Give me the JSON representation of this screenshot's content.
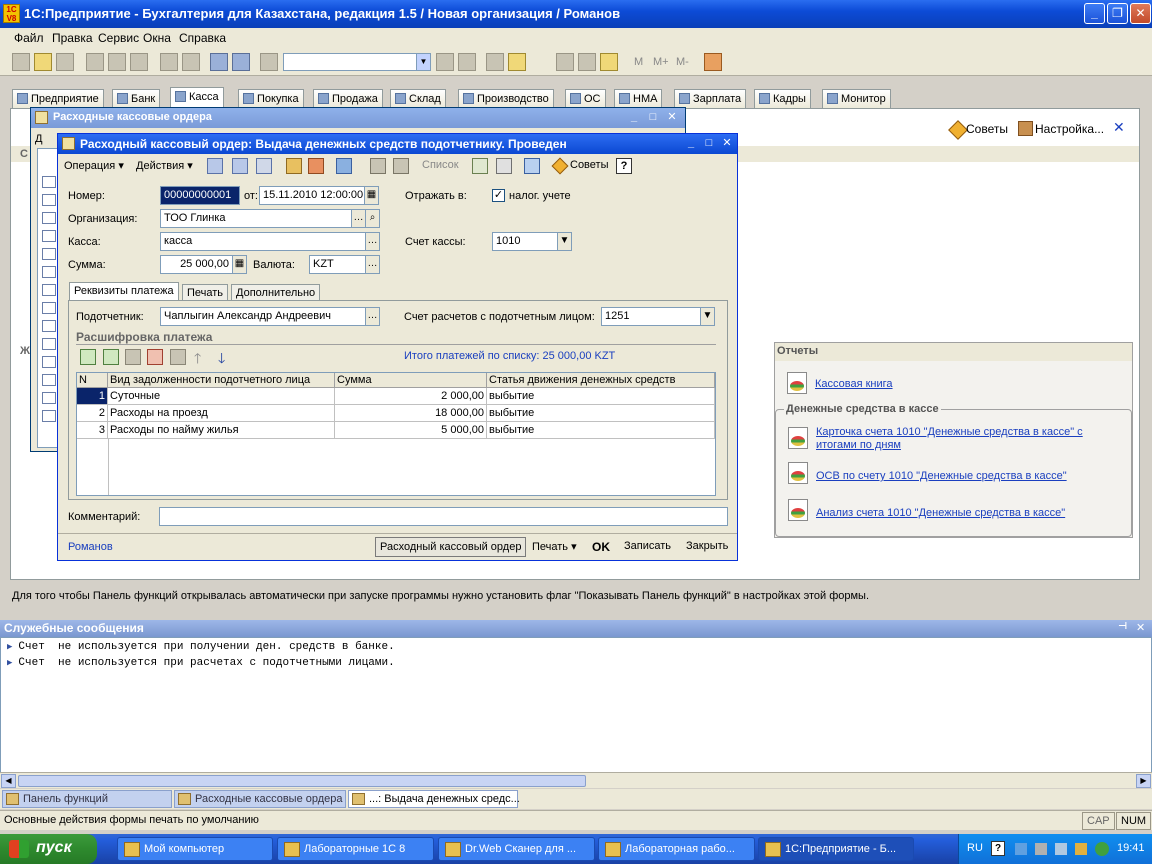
{
  "app": {
    "title": "1С:Предприятие - Бухгалтерия для Казахстана, редакция 1.5 / Новая организация / Романов",
    "icon_text": "1C V8"
  },
  "menu": [
    "Файл",
    "Правка",
    "Сервис",
    "Окна",
    "Справка"
  ],
  "toolbar_mem": [
    "M",
    "M+",
    "M-"
  ],
  "tabs": [
    "Предприятие",
    "Банк",
    "Касса",
    "Покупка",
    "Продажа",
    "Склад",
    "Производство",
    "ОС",
    "НМА",
    "Зарплата",
    "Кадры",
    "Монитор"
  ],
  "panel": {
    "sovety": "Советы",
    "nastroyka": "Настройка...",
    "otchety": "Отчеты",
    "kassovaya_kniga": "Кассовая книга",
    "group_title": "Денежные средства в кассе",
    "link_kartochka": "Карточка счета 1010 \"Денежные средства в кассе\" с итогами по дням",
    "link_osv": "ОСВ по счету 1010 \"Денежные средства в кассе\"",
    "link_analiz": "Анализ счета 1010 \"Денежные средства в кассе\"",
    "hint": "Для того чтобы Панель функций открывалась автоматически при запуске программы нужно установить флаг \"Показывать Панель функций\" в настройках этой формы.",
    "letters": [
      "Д",
      "С",
      "Ж"
    ]
  },
  "list_window": {
    "title": "Расходные кассовые ордера"
  },
  "form": {
    "title": "Расходный кассовый ордер: Выдача денежных средств подотчетнику. Проведен",
    "toolbar": {
      "operation": "Операция",
      "actions": "Действия",
      "list": "Список",
      "tips": "Советы",
      "help": "?"
    },
    "labels": {
      "nomer": "Номер:",
      "ot": "от:",
      "organization": "Организация:",
      "kassa": "Касса:",
      "summa": "Сумма:",
      "valuta": "Валюта:",
      "otrazhat": "Отражать в:",
      "nalog": "налог. учете",
      "schet_kassy": "Счет кассы:"
    },
    "values": {
      "nomer": "00000000001",
      "date": "15.11.2010 12:00:00",
      "organization": "ТОО Глинка",
      "kassa": "касса",
      "summa": "25 000,00",
      "valuta": "KZT",
      "schet_kassy": "1010"
    },
    "tabs": [
      "Реквизиты платежа",
      "Печать",
      "Дополнительно"
    ],
    "payment": {
      "podotchetnik_label": "Подотчетник:",
      "podotchetnik": "Чаплыгин Александр Андреевич",
      "schet_label": "Счет расчетов с подотчетным лицом:",
      "schet": "1251",
      "section": "Расшифровка платежа",
      "total": "Итого платежей по списку: 25 000,00 KZT"
    },
    "grid": {
      "headers": [
        "N",
        "Вид задолженности подотчетного лица",
        "Сумма",
        "Статья движения денежных средств"
      ],
      "rows": [
        [
          "1",
          "Суточные",
          "2 000,00",
          "выбытие"
        ],
        [
          "2",
          "Расходы на проезд",
          "18 000,00",
          "выбытие"
        ],
        [
          "3",
          "Расходы по найму жилья",
          "5 000,00",
          "выбытие"
        ]
      ]
    },
    "comment_label": "Комментарий:",
    "author": "Романов",
    "buttons": {
      "rko": "Расходный кассовый ордер",
      "print": "Печать",
      "ok": "OK",
      "save": "Записать",
      "close": "Закрыть"
    }
  },
  "messages": {
    "title": "Служебные сообщения",
    "lines": [
      "Счет  не используется при получении ден. средств в банке.",
      "Счет  не используется при расчетах с подотчетными лицами."
    ]
  },
  "window_tabs": [
    "Панель функций",
    "Расходные кассовые ордера",
    "...: Выдача денежных средс..."
  ],
  "status": {
    "text": "Основные действия формы печать по умолчанию",
    "cap": "CAP",
    "num": "NUM"
  },
  "taskbar": {
    "start": "пуск",
    "items": [
      "Мой компьютер",
      "Лабораторные 1С 8",
      "Dr.Web Сканер для ...",
      "Лабораторная рабо...",
      "1С:Предприятие - Б..."
    ],
    "lang": "RU",
    "time": "19:41"
  }
}
